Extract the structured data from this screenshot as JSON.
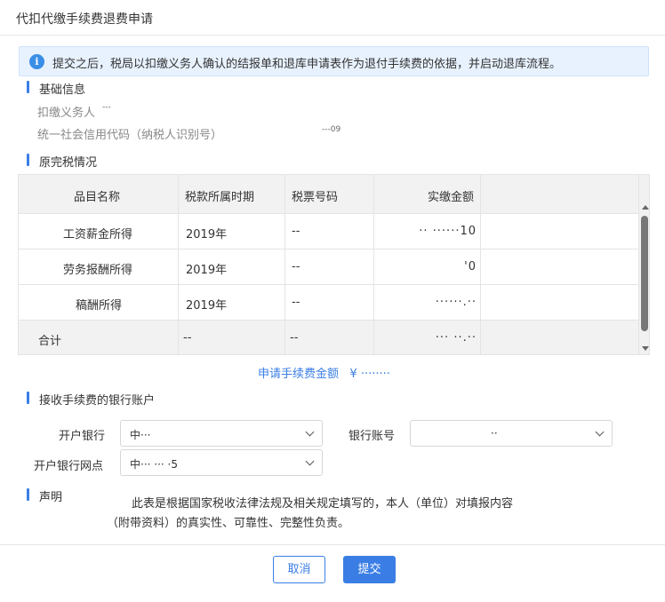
{
  "dialog": {
    "title": "代扣代缴手续费退费申请"
  },
  "notice": {
    "icon": "info-icon",
    "glyph": "i",
    "text": "提交之后，税局以扣缴义务人确认的结报单和退库申请表作为退付手续费的依据，并启动退库流程。"
  },
  "basic": {
    "title": "基础信息",
    "withholder_label": "扣缴义务人",
    "withholder_value": "---",
    "credit_code_label": "统一社会信用代码（纳税人识别号）",
    "credit_code_value": "---09"
  },
  "original": {
    "title": "原完税情况",
    "headers": [
      "品目名称",
      "税款所属时期",
      "税票号码",
      "实缴金额"
    ],
    "rows": [
      {
        "item": "工资薪金所得",
        "period": "2019年",
        "ticket": "--",
        "amount": "··  ······10"
      },
      {
        "item": "劳务报酬所得",
        "period": "2019年",
        "ticket": "--",
        "amount": "'0"
      },
      {
        "item": "稿酬所得",
        "period": "2019年",
        "ticket": "--",
        "amount": "······.··"
      }
    ],
    "total": {
      "label": "合计",
      "period": "--",
      "ticket": "--",
      "amount": "···  ··.··"
    }
  },
  "fee": {
    "label": "申请手续费金额",
    "value": "¥ ········"
  },
  "bank": {
    "title": "接收手续费的银行账户",
    "bank_label": "开户银行",
    "bank_value": "中···",
    "account_label": "银行账号",
    "account_value": "··",
    "branch_label": "开户银行网点",
    "branch_value": "中···  ···  ·5"
  },
  "declaration": {
    "title": "声明",
    "line1": "此表是根据国家税收法律法规及相关规定填写的，本人（单位）对填报内容",
    "line2": "（附带资料）的真实性、可靠性、完整性负责。"
  },
  "actions": {
    "cancel": "取消",
    "submit": "提交"
  },
  "colors": {
    "accent": "#3a7ee5",
    "notice_bg": "#e8f2ff"
  }
}
